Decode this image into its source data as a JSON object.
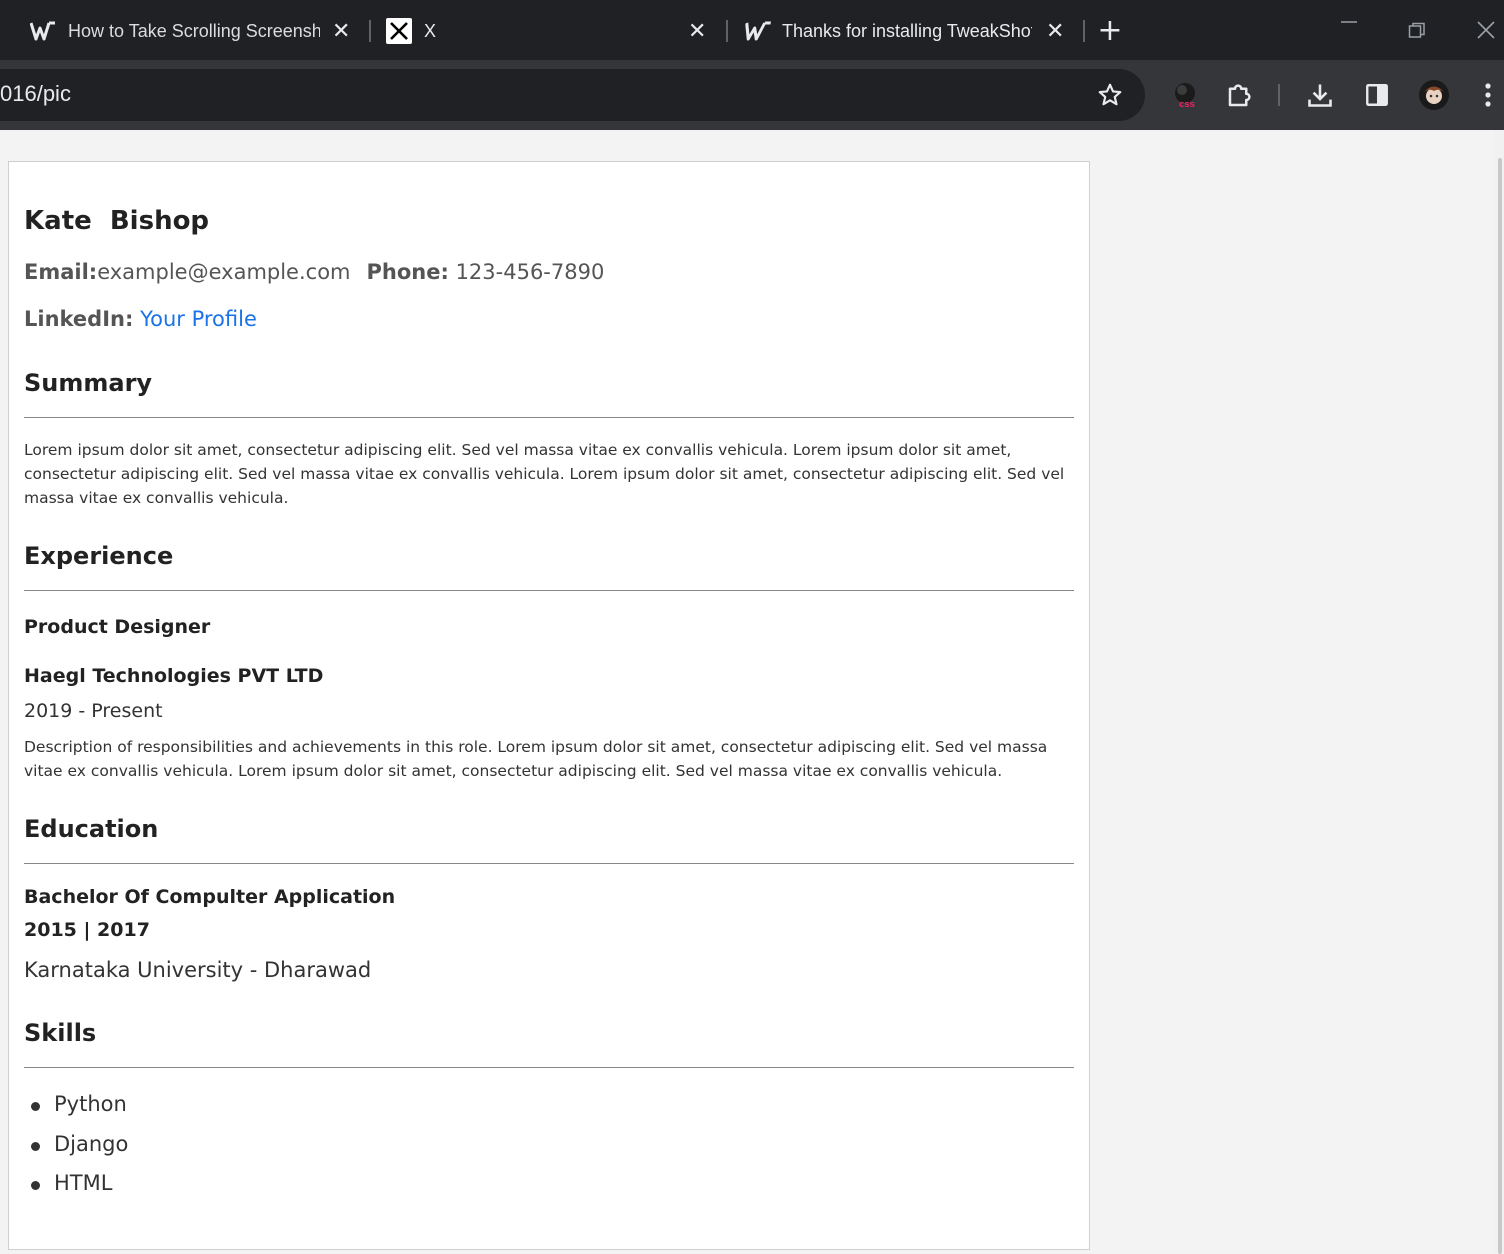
{
  "browser": {
    "tabs": [
      {
        "title": "How to Take Scrolling Screensh",
        "favicon": "wordmark-w-icon"
      },
      {
        "title": "X",
        "favicon": "x-logo-icon"
      },
      {
        "title": "Thanks for installing TweakShot",
        "favicon": "wordmark-w-icon"
      }
    ],
    "address": "016/pic",
    "toolbar_icons": [
      "star-icon",
      "css-extension-icon",
      "extensions-puzzle-icon",
      "download-icon",
      "side-panel-icon",
      "profile-avatar",
      "menu-kebab-icon"
    ]
  },
  "resume": {
    "name": "Kate  Bishop",
    "contact": {
      "email_label": "Email:",
      "email": "example@example.com",
      "phone_label": "Phone:",
      "phone": "123-456-7890",
      "linkedin_label": "LinkedIn:",
      "linkedin_text": "Your Profile"
    },
    "summary": {
      "heading": "Summary",
      "text": "Lorem ipsum dolor sit amet, consectetur adipiscing elit. Sed vel massa vitae ex convallis vehicula. Lorem ipsum dolor sit amet, consectetur adipiscing elit. Sed vel massa vitae ex convallis vehicula. Lorem ipsum dolor sit amet, consectetur adipiscing elit. Sed vel massa vitae ex convallis vehicula."
    },
    "experience": {
      "heading": "Experience",
      "role": "Product Designer",
      "company": "Haegl Technologies PVT LTD",
      "period": "2019 - Present",
      "description": "Description of responsibilities and achievements in this role. Lorem ipsum dolor sit amet, consectetur adipiscing elit. Sed vel massa vitae ex convallis vehicula. Lorem ipsum dolor sit amet, consectetur adipiscing elit. Sed vel massa vitae ex convallis vehicula."
    },
    "education": {
      "heading": "Education",
      "degree": "Bachelor Of Compulter Application",
      "years": "2015 | 2017",
      "institution": "Karnataka University - Dharawad"
    },
    "skills": {
      "heading": "Skills",
      "items": [
        "Python",
        "Django",
        "HTML"
      ]
    }
  }
}
